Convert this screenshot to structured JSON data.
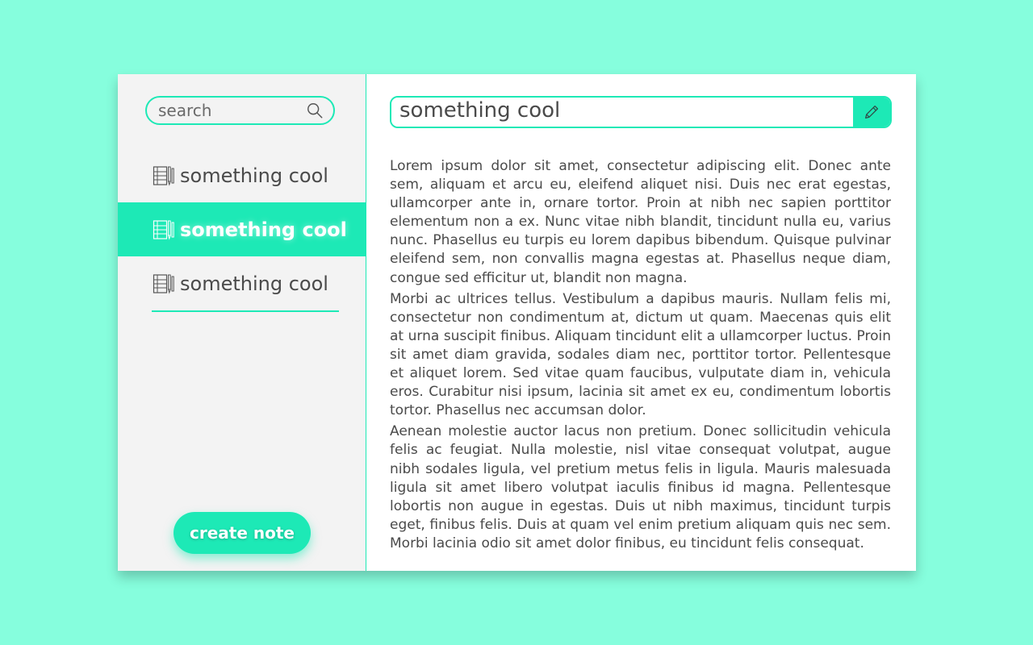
{
  "sidebar": {
    "search": {
      "placeholder": "search",
      "value": ""
    },
    "notes": [
      {
        "label": "something cool",
        "active": false
      },
      {
        "label": "something cool",
        "active": true
      },
      {
        "label": "something cool",
        "active": false
      }
    ],
    "create_label": "create note"
  },
  "editor": {
    "title": "something cool",
    "paragraphs": [
      "Lorem ipsum dolor sit amet, consectetur adipiscing elit. Donec ante sem, aliquam et arcu eu, eleifend aliquet nisi. Duis nec erat egestas, ullamcorper ante in, ornare tortor. Proin at nibh nec sapien porttitor elementum non a ex. Nunc vitae nibh blandit, tincidunt nulla eu, varius nunc. Phasellus eu turpis eu lorem dapibus bibendum. Quisque pulvinar eleifend sem, non convallis magna egestas at. Phasellus neque diam, congue sed efficitur ut, blandit non magna.",
      "Morbi ac ultrices tellus. Vestibulum a dapibus mauris. Nullam felis mi, consectetur non condimentum at, dictum ut quam. Maecenas quis elit at urna suscipit finibus. Aliquam tincidunt elit a ullamcorper luctus. Proin sit amet diam gravida, sodales diam nec, porttitor tortor. Pellentesque et aliquet lorem. Sed vitae quam faucibus, vulputate diam in, vehicula eros. Curabitur nisi ipsum, lacinia sit amet ex eu, condimentum lobortis tortor. Phasellus nec accumsan dolor.",
      "Aenean molestie auctor lacus non pretium. Donec sollicitudin vehicula felis ac feugiat. Nulla molestie, nisl vitae consequat volutpat, augue nibh sodales ligula, vel pretium metus felis in ligula. Mauris malesuada ligula sit amet libero volutpat iaculis finibus id magna. Pellentesque lobortis non augue in egestas. Duis ut nibh maximus, tincidunt turpis eget, finibus felis. Duis at quam vel enim pretium aliquam quis nec sem. Morbi lacinia odio sit amet dolor finibus, eu tincidunt felis consequat."
    ]
  },
  "icons": {
    "search": "search-icon",
    "note": "notebook-pencil-icon",
    "edit": "pencil-icon"
  },
  "colors": {
    "background": "#86fedd",
    "accent": "#1de9b6",
    "sidebar_bg": "#f3f3f3",
    "text": "#4a4a4a"
  }
}
